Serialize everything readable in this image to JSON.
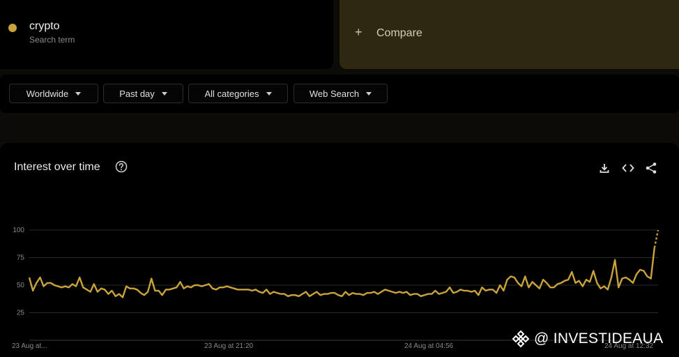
{
  "search_term": {
    "name": "crypto",
    "subtitle": "Search term",
    "color": "#c9a33b"
  },
  "compare": {
    "label": "Compare"
  },
  "filters": [
    {
      "label": "Worldwide"
    },
    {
      "label": "Past day"
    },
    {
      "label": "All categories"
    },
    {
      "label": "Web Search"
    }
  ],
  "chart": {
    "title": "Interest over time"
  },
  "watermark": {
    "text": "@ INVESTIDEAUA"
  },
  "chart_data": {
    "type": "line",
    "title": "Interest over time",
    "xlabel": "",
    "ylabel": "",
    "ylim": [
      0,
      100
    ],
    "yticks": [
      25,
      50,
      75,
      100
    ],
    "grid": true,
    "xtick_labels": [
      "23 Aug at...",
      "23 Aug at 21:20",
      "24 Aug at 04:56",
      "24 Aug at 12:32"
    ],
    "series": [
      {
        "name": "crypto",
        "color": "#c9a33b",
        "values": [
          57,
          45,
          52,
          57,
          49,
          52,
          52,
          50,
          49,
          48,
          49,
          48,
          51,
          49,
          57,
          48,
          46,
          44,
          51,
          44,
          47,
          46,
          42,
          45,
          40,
          42,
          39,
          49,
          47,
          47,
          46,
          43,
          41,
          44,
          56,
          45,
          45,
          41,
          46,
          46,
          47,
          48,
          53,
          47,
          49,
          48,
          50,
          50,
          49,
          50,
          51,
          47,
          46,
          48,
          48,
          49,
          48,
          47,
          46,
          46,
          46,
          46,
          45,
          46,
          44,
          43,
          46,
          42,
          44,
          43,
          42,
          42,
          40,
          41,
          41,
          40,
          42,
          44,
          40,
          42,
          44,
          41,
          42,
          42,
          43,
          43,
          41,
          40,
          44,
          41,
          43,
          42,
          42,
          41,
          43,
          43,
          44,
          42,
          44,
          46,
          45,
          44,
          43,
          44,
          43,
          44,
          41,
          42,
          42,
          40,
          41,
          42,
          42,
          45,
          42,
          43,
          44,
          48,
          43,
          44,
          46,
          45,
          45,
          44,
          45,
          41,
          48,
          45,
          46,
          46,
          43,
          50,
          45,
          55,
          58,
          57,
          52,
          49,
          58,
          48,
          53,
          50,
          47,
          55,
          52,
          48,
          48,
          51,
          52,
          54,
          55,
          62,
          52,
          54,
          49,
          55,
          53,
          63,
          52,
          47,
          49,
          46,
          57,
          73,
          48,
          56,
          57,
          55,
          52,
          60,
          64,
          63,
          58,
          56,
          84,
          100
        ]
      }
    ]
  }
}
